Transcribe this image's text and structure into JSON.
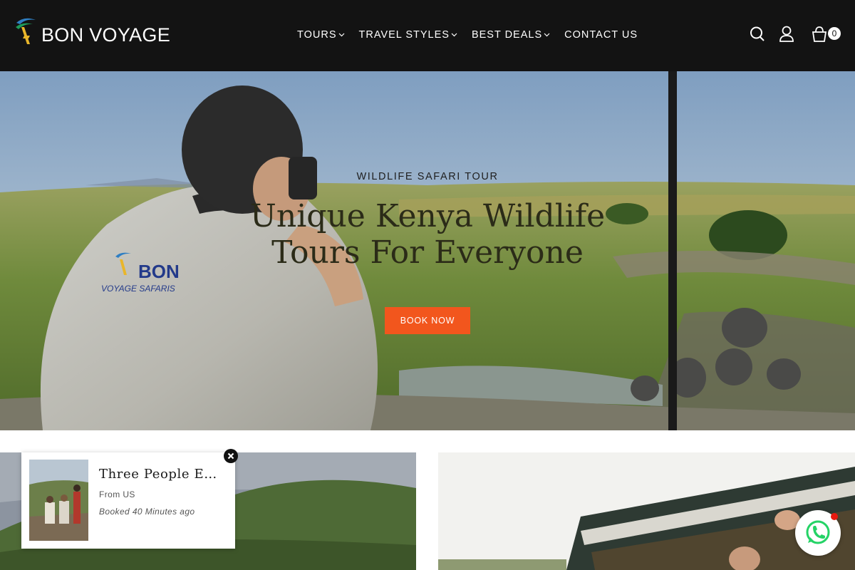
{
  "header": {
    "logo_text": "BON VOYAGE",
    "nav": [
      {
        "label": "TOURS",
        "has_dropdown": true
      },
      {
        "label": "TRAVEL STYLES",
        "has_dropdown": true
      },
      {
        "label": "BEST DEALS",
        "has_dropdown": true
      },
      {
        "label": "CONTACT US",
        "has_dropdown": false
      }
    ],
    "icons": [
      "search-icon",
      "user-icon",
      "cart-icon"
    ],
    "cart_count": "0"
  },
  "hero": {
    "subtitle": "WILDLIFE SAFARI TOUR",
    "title": "Unique Kenya Wildlife Tours For Everyone",
    "cta": "BOOK NOW",
    "shirt_logo_line1": "BON",
    "shirt_logo_line2": "VOYAGE SAFARIS"
  },
  "popup": {
    "title": "Three People Enjoying",
    "from": "From US",
    "time": "Booked 40 Minutes ago"
  },
  "colors": {
    "header_bg": "#131313",
    "accent": "#f2561d",
    "whatsapp": "#25d366"
  }
}
